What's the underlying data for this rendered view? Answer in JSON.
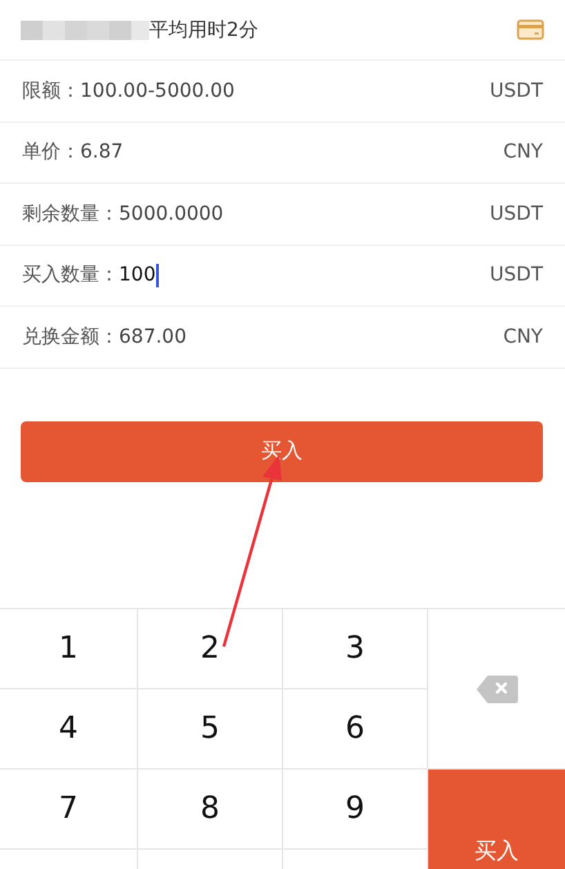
{
  "header": {
    "text": "平均用时2分"
  },
  "rows": [
    {
      "kind": "info",
      "label": "限额：",
      "value": "100.00-5000.00",
      "unit": "USDT"
    },
    {
      "kind": "info",
      "label": "单价：",
      "value": "6.87",
      "unit": "CNY"
    },
    {
      "kind": "info",
      "label": "剩余数量：",
      "value": "5000.0000",
      "unit": "USDT"
    },
    {
      "kind": "input",
      "label": "买入数量：",
      "value": "100",
      "unit": "USDT"
    },
    {
      "kind": "info",
      "label": "兑换金额：",
      "value": "687.00",
      "unit": "CNY"
    }
  ],
  "buy_button": "买入",
  "keypad": {
    "keys": [
      "1",
      "2",
      "3",
      "4",
      "5",
      "6",
      "7",
      "8",
      "9"
    ],
    "confirm": "买入"
  }
}
